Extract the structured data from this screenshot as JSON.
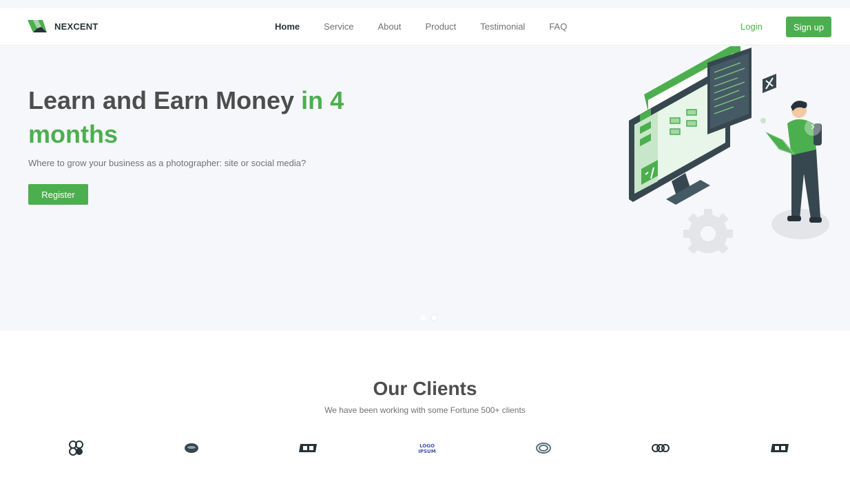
{
  "header": {
    "brand": "NEXCENT",
    "logo_icon": "nexcent-logo-icon",
    "nav": [
      {
        "label": "Home",
        "active": true
      },
      {
        "label": "Service"
      },
      {
        "label": "About"
      },
      {
        "label": "Product"
      },
      {
        "label": "Testimonial"
      },
      {
        "label": "FAQ"
      }
    ],
    "login_label": "Login",
    "signup_label": "Sign up"
  },
  "hero": {
    "title_main": "Learn and Earn Money ",
    "title_accent": "in 4 months",
    "subtitle": "Where to grow your business as a photographer: site or social media?",
    "register_label": "Register",
    "illustration_icon": "developer-illustration",
    "next_icon": "chevron-right-icon",
    "slides_total": 2,
    "active_slide": 2
  },
  "clients": {
    "title": "Our Clients",
    "subtitle": "We have been working with some Fortune 500+ clients",
    "logos": [
      "client-logo-1-icon",
      "client-logo-2-icon",
      "client-logo-3-icon",
      "client-logo-4-icon",
      "client-logo-5-icon",
      "client-logo-6-icon",
      "client-logo-7-icon"
    ]
  },
  "colors": {
    "primary": "#4caf4f",
    "heading": "#4d4d4d",
    "text": "#717171",
    "hero_bg": "#f5f7fa",
    "dark": "#263238"
  }
}
